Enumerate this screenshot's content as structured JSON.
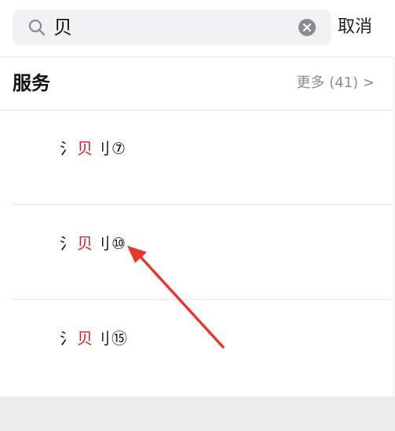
{
  "search": {
    "query": "贝",
    "search_icon": "search-icon",
    "clear_icon": "clear-circle-icon",
    "cancel_label": "取消"
  },
  "section": {
    "title": "服务",
    "more_label": "更多 (41) >"
  },
  "results": [
    {
      "prefix": "氵",
      "highlight": "贝",
      "suffix": "刂⑦"
    },
    {
      "prefix": "氵",
      "highlight": "贝",
      "suffix": "刂⑩"
    },
    {
      "prefix": "氵",
      "highlight": "贝",
      "suffix": "刂⑮"
    }
  ],
  "colors": {
    "highlight": "#e02020",
    "annotation_arrow": "#e8382e",
    "search_box_bg": "#f1f1f3",
    "secondary_text": "#8c8c8c"
  }
}
